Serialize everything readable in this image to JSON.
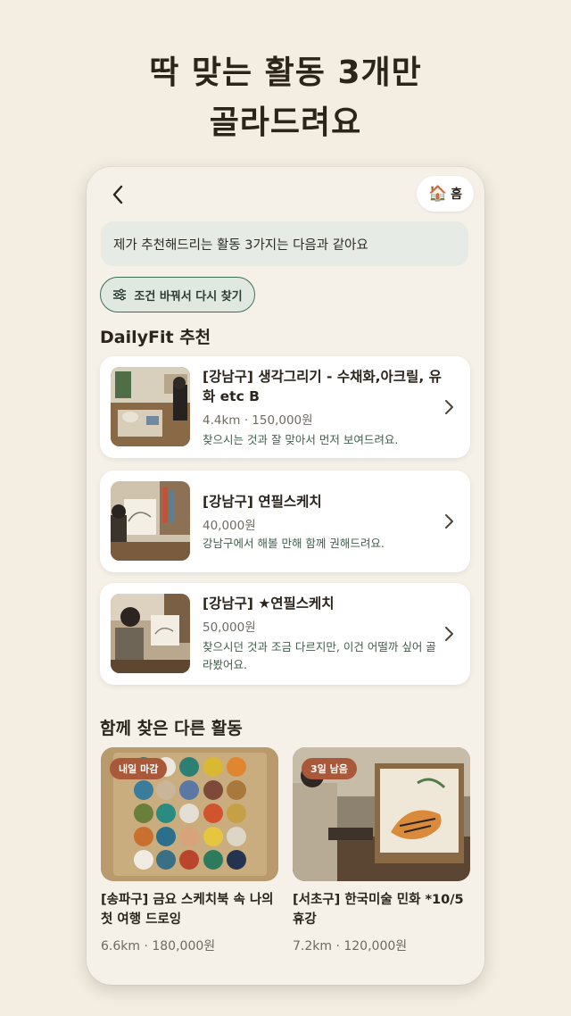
{
  "headline": {
    "line1": "딱 맞는 활동 3개만",
    "line2": "골라드려요"
  },
  "header": {
    "home_icon": "🏠",
    "home_label": "홈",
    "back_icon": "chevron-left-icon"
  },
  "intro": "제가 추천해드리는 활동 3가지는 다음과 같아요",
  "filter_button": {
    "icon": "sliders-icon",
    "label": "조건 바꿔서 다시 찾기"
  },
  "recommend_section": "DailyFit 추천",
  "recommendations": [
    {
      "title": "[강남구] 생각그리기 - 수채화,아크릴, 유화 etc B",
      "meta": "4.4km · 150,000원",
      "reason": "찾으시는 것과 잘 맞아서 먼저 보여드려요."
    },
    {
      "title": "[강남구] 연필스케치",
      "meta": "40,000원",
      "reason": "강남구에서 해볼 만해 함께 권해드려요."
    },
    {
      "title": "[강남구] ★연필스케치",
      "meta": "50,000원",
      "reason": "찾으시던 것과 조금 다르지만, 이건 어떨까 싶어 골라봤어요."
    }
  ],
  "other_section": "함께 찾은 다른 활동",
  "others": [
    {
      "badge": "내일 마감",
      "title": "[송파구] 금요 스케치북 속 나의 첫 여행 드로잉",
      "meta": "6.6km · 180,000원"
    },
    {
      "badge": "3일 남음",
      "title": "[서초구] 한국미술 민화 *10/5 휴강",
      "meta": "7.2km · 120,000원"
    }
  ],
  "colors": {
    "background": "#f3ede2",
    "accent_green": "#3e6e57",
    "badge": "#a9583a"
  }
}
